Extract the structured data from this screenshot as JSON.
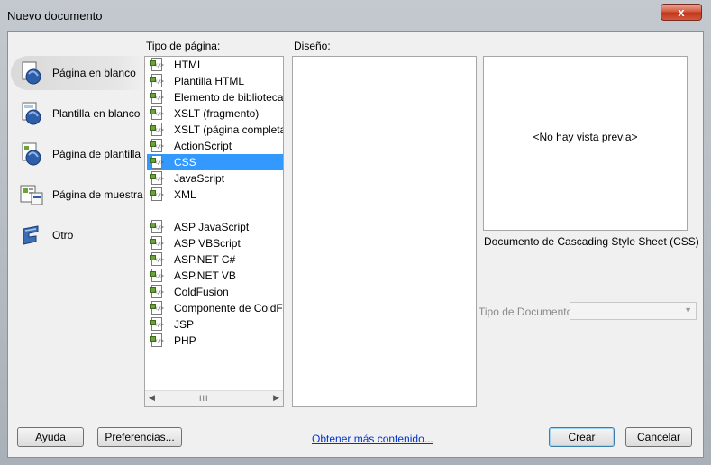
{
  "window": {
    "title": "Nuevo documento",
    "close_glyph": "x"
  },
  "categories": [
    {
      "label": "Página en blanco",
      "icon": "blank-page-icon",
      "selected": true
    },
    {
      "label": "Plantilla en blanco",
      "icon": "blank-template-icon",
      "selected": false
    },
    {
      "label": "Página de plantilla",
      "icon": "template-page-icon",
      "selected": false
    },
    {
      "label": "Página de muestra",
      "icon": "sample-page-icon",
      "selected": false
    },
    {
      "label": "Otro",
      "icon": "other-icon",
      "selected": false
    }
  ],
  "page_type": {
    "label": "Tipo de página:",
    "items": [
      "HTML",
      "Plantilla HTML",
      "Elemento de biblioteca",
      "XSLT (fragmento)",
      "XSLT (página completa)",
      "ActionScript",
      "CSS",
      "JavaScript",
      "XML",
      "ASP JavaScript",
      "ASP VBScript",
      "ASP.NET C#",
      "ASP.NET VB",
      "ColdFusion",
      "Componente de ColdFusion",
      "JSP",
      "PHP"
    ],
    "selected": "CSS",
    "scroll_grip": "III"
  },
  "design": {
    "label": "Diseño:"
  },
  "preview": {
    "text": "<No hay vista previa>",
    "description": "Documento de Cascading Style Sheet (CSS)"
  },
  "doctype": {
    "label": "Tipo de Documento:",
    "value": ""
  },
  "buttons": {
    "help": "Ayuda",
    "preferences": "Preferencias...",
    "more_content": "Obtener más contenido...",
    "create": "Crear",
    "cancel": "Cancelar"
  },
  "colors": {
    "selection": "#3399ff",
    "link": "#0033cc"
  }
}
